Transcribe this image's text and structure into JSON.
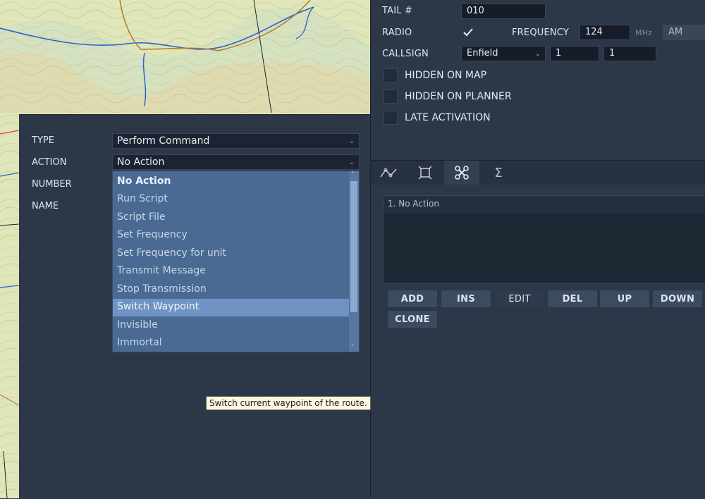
{
  "colors": {
    "panel": "#2c3747",
    "field": "#1b2330",
    "dropdown": "#4a6a94",
    "dropdown_selected": "#6f93c3",
    "button": "#3b4b62",
    "map_land": "#d9e2b3",
    "river": "#2d5fd0",
    "road": "#b27a2c",
    "tooltip_bg": "#fbf8df"
  },
  "unit": {
    "tail_label": "TAIL #",
    "tail_value": "010",
    "radio_label": "RADIO",
    "radio_checked": true,
    "frequency_label": "FREQUENCY",
    "frequency_value": "124",
    "frequency_unit": "MHz",
    "modulation": "AM",
    "callsign_label": "CALLSIGN",
    "callsign_name": "Enfield",
    "callsign_num1": "1",
    "callsign_num2": "1",
    "hidden_on_map": "HIDDEN ON MAP",
    "hidden_on_planner": "HIDDEN ON PLANNER",
    "late_activation": "LATE ACTIVATION"
  },
  "tabs": [
    {
      "icon": "route-icon"
    },
    {
      "icon": "target-icon",
      "active": false
    },
    {
      "icon": "command-icon",
      "active": true
    },
    {
      "icon": "sigma-icon"
    }
  ],
  "actions_list": {
    "items": [
      "1. No Action"
    ]
  },
  "buttons": {
    "add": "ADD",
    "ins": "INS",
    "edit": "EDIT",
    "del": "DEL",
    "up": "UP",
    "down": "DOWN",
    "clone": "CLONE"
  },
  "action_panel": {
    "type_label": "TYPE",
    "type_value": "Perform Command",
    "action_label": "ACTION",
    "action_value": "No Action",
    "number_label": "NUMBER",
    "name_label": "NAME",
    "dropdown_items": [
      "No Action",
      "Run Script",
      "Script File",
      "Set Frequency",
      "Set Frequency for unit",
      "Transmit Message",
      "Stop Transmission",
      "Switch Waypoint",
      "Invisible",
      "Immortal"
    ],
    "dropdown_selected": "Switch Waypoint",
    "tooltip": "Switch current waypoint of the route."
  }
}
